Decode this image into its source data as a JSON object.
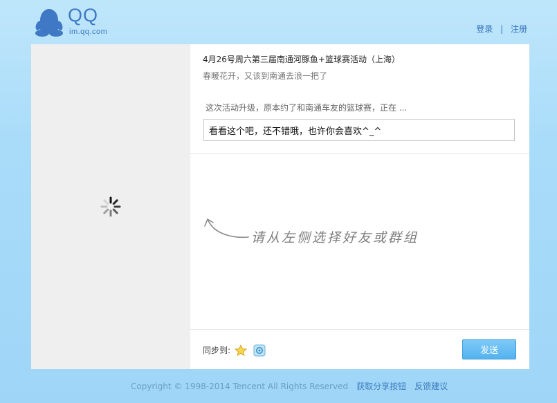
{
  "header": {
    "logo_name": "QQ",
    "logo_url": "im.qq.com",
    "login_label": "登录",
    "separator": "|",
    "register_label": "注册"
  },
  "left_pane": {
    "spinner_icon": "loading-spinner-icon"
  },
  "share": {
    "title": "4月26号周六第三届南通河豚鱼+篮球赛活动（上海）",
    "subtitle": "春暖花开，又该到南通去浪一把了",
    "summary": "这次活动升级，原本约了和南通车友的篮球赛，正在 ...",
    "message_value": "看看这个吧，还不错哦，也许你会喜欢^_^"
  },
  "select_area": {
    "hint_text": "请从左侧选择好友或群组",
    "arrow_icon": "curved-arrow-icon"
  },
  "footer_bar": {
    "sync_label": "同步到:",
    "sync_targets": [
      "star-icon",
      "qzone-icon"
    ],
    "send_label": "发送"
  },
  "footer": {
    "copyright": "Copyright © 1998-2014 Tencent All Rights Reserved",
    "share_button_link": "获取分享按钮",
    "feedback_link": "反馈建议"
  },
  "colors": {
    "page_background": "#a9dcf9",
    "accent": "#53b2ee",
    "link": "#2f6db7"
  }
}
